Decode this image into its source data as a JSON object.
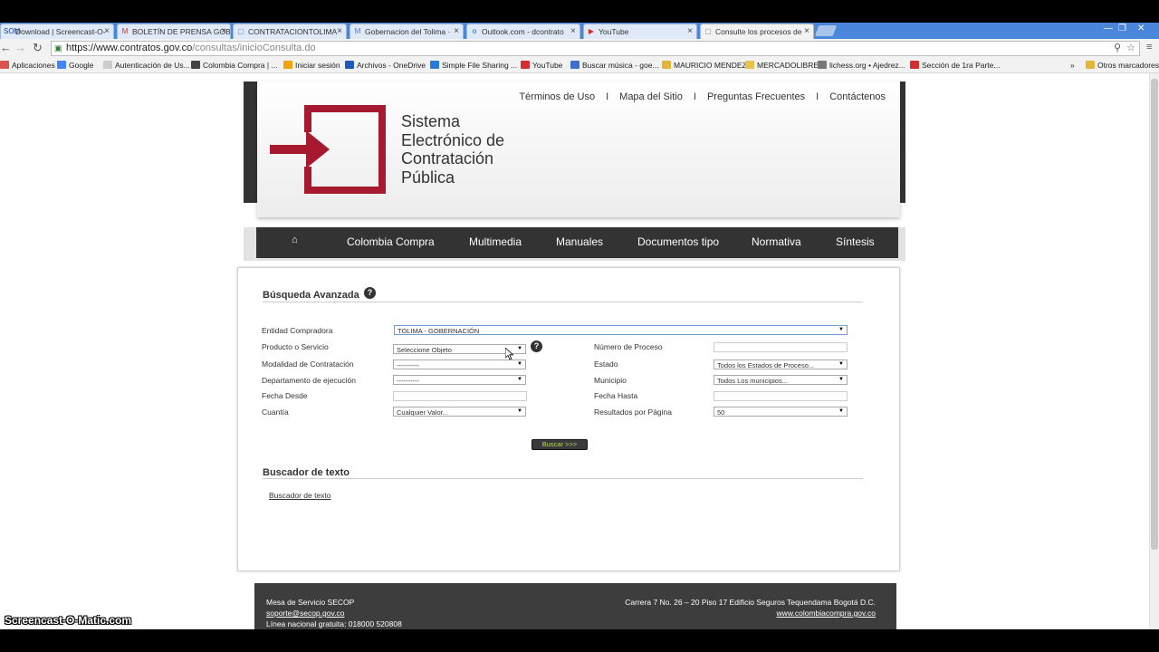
{
  "browser": {
    "tabs": [
      {
        "label": "Download | Screencast-O-",
        "fav": "SOM",
        "color": "#1a3d8c"
      },
      {
        "label": "BOLETÍN DE PRENSA GOB",
        "fav": "M",
        "color": "#c23321"
      },
      {
        "label": "CONTRATACIONTOLIMA",
        "fav": "▢",
        "color": "#5a8ad0"
      },
      {
        "label": "Gobernacion del Tolima ·",
        "fav": "M",
        "color": "#4b7bd0"
      },
      {
        "label": "Outlook.com - dcontrato",
        "fav": "o",
        "color": "#0a64b5"
      },
      {
        "label": "YouTube",
        "fav": "▶",
        "color": "#d32f2f"
      },
      {
        "label": "Consulte los procesos de",
        "fav": "▢",
        "color": "#888888"
      }
    ],
    "url_host": "https://www.contratos.gov.co",
    "url_path": "/consultas/inicioConsulta.do",
    "bookmarks": [
      {
        "label": "Aplicaciones",
        "color": "#d9534f"
      },
      {
        "label": "Google",
        "color": "#4285f4"
      },
      {
        "label": "Autenticación de Us...",
        "color": "#cccccc"
      },
      {
        "label": "Colombia Compra | ...",
        "color": "#444444"
      },
      {
        "label": "Iniciar sesión",
        "color": "#f0a30a"
      },
      {
        "label": "Archivos - OneDrive",
        "color": "#1e5bb8"
      },
      {
        "label": "Simple File Sharing ...",
        "color": "#2a7bd8"
      },
      {
        "label": "YouTube",
        "color": "#d32f2f"
      },
      {
        "label": "Buscar música - goe...",
        "color": "#3b6fd0"
      },
      {
        "label": "MAURICIO MENDEZ",
        "color": "#e5b53a"
      },
      {
        "label": "MERCADOLIBRE",
        "color": "#e8c24a"
      },
      {
        "label": "lichess.org • Ajedrez...",
        "color": "#777777"
      },
      {
        "label": "Sección de 1ra Parte...",
        "color": "#d32f2f"
      }
    ],
    "bookmarks_more": "»",
    "other_bookmarks": "Otros marcadores"
  },
  "header": {
    "top_links": [
      "Términos de Uso",
      "Mapa del Sitio",
      "Preguntas Frecuentes",
      "Contáctenos"
    ],
    "separator": "I",
    "logo_lines": [
      "Sistema",
      "Electrónico de",
      "Contratación",
      "Pública"
    ],
    "logo_color": "#a6192e"
  },
  "nav": {
    "home_icon": "home-icon",
    "items": [
      "Colombia Compra",
      "Multimedia",
      "Manuales",
      "Documentos tipo",
      "Normativa",
      "Síntesis"
    ]
  },
  "search": {
    "title": "Búsqueda Avanzada",
    "help": "?",
    "labels": {
      "entidad": "Entidad Compradora",
      "producto": "Producto o Servicio",
      "numero": "Número de Proceso",
      "modalidad": "Modalidad de Contratación",
      "estado": "Estado",
      "departamento": "Departamento de ejecución",
      "municipio": "Municipio",
      "fecha_desde": "Fecha Desde",
      "fecha_hasta": "Fecha Hasta",
      "cuantia": "Cuantía",
      "resultados": "Resultados por Página"
    },
    "values": {
      "entidad": "TOLIMA - GOBERNACIÓN",
      "producto": "Seleccione Objeto",
      "modalidad": "----------",
      "estado": "Todos los Estados de Proceso...",
      "departamento": "----------",
      "municipio": "Todos Los municipios...",
      "cuantia": "Cualquier Valor...",
      "resultados": "50"
    },
    "button": "Buscar >>>"
  },
  "text_search": {
    "title": "Buscador de texto",
    "link": "Buscador de texto"
  },
  "footer": {
    "line1": "Mesa de Servicio SECOP",
    "email": "soporte@secop.gov.co",
    "phone": "Línea nacional gratuita: 018000 520808",
    "address": "Carrera 7 No. 26 – 20 Piso 17 Edificio Seguros Tequendama Bogotá D.C.",
    "website": "www.colombiacompra.gov.co"
  },
  "watermark": "Screencast-O-Matic.com"
}
